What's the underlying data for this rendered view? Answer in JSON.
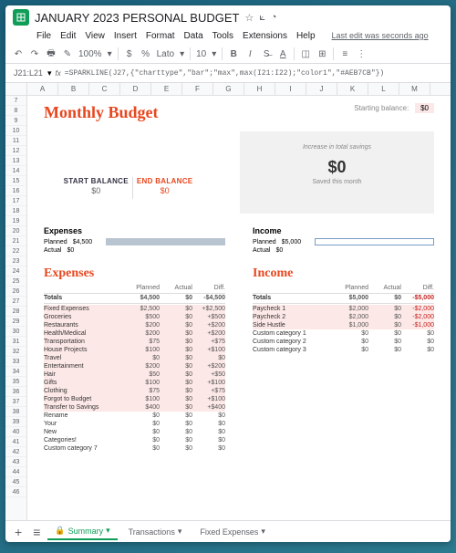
{
  "doc": {
    "name": "JANUARY 2023 PERSONAL BUDGET",
    "lastedit": "Last edit was seconds ago"
  },
  "menus": [
    "File",
    "Edit",
    "View",
    "Insert",
    "Format",
    "Data",
    "Tools",
    "Extensions",
    "Help"
  ],
  "toolbar": {
    "zoom": "100%",
    "font": "Lato",
    "fontsize": "10"
  },
  "formula": {
    "cell": "J21:L21",
    "fx": "fx",
    "value": "=SPARKLINE(J27,{\"charttype\",\"bar\";\"max\",max(I21:I22);\"color1\",\"#AEB7CB\"})"
  },
  "cols": [
    "A",
    "B",
    "C",
    "D",
    "E",
    "F",
    "G",
    "H",
    "I",
    "J",
    "K",
    "L",
    "M"
  ],
  "rows": [
    "7",
    "8",
    "9",
    "10",
    "11",
    "12",
    "13",
    "14",
    "15",
    "16",
    "17",
    "18",
    "19",
    "20",
    "21",
    "22",
    "23",
    "24",
    "25",
    "26",
    "27",
    "28",
    "29",
    "30",
    "31",
    "32",
    "33",
    "34",
    "35",
    "36",
    "37",
    "38",
    "39",
    "40",
    "41",
    "42",
    "43",
    "44",
    "45",
    "46"
  ],
  "title": "Monthly Budget",
  "startbal": {
    "label": "Starting balance:",
    "value": "$0"
  },
  "bal": {
    "startlab": "START BALANCE",
    "startval": "$0",
    "endlab": "END BALANCE",
    "endval": "$0"
  },
  "savings": {
    "lab1": "Increase in total savings",
    "value": "$0",
    "lab2": "Saved this month"
  },
  "exp": {
    "label": "Expenses",
    "planned_lab": "Planned",
    "planned_val": "$4,500",
    "actual_lab": "Actual",
    "actual_val": "$0"
  },
  "inc": {
    "label": "Income",
    "planned_lab": "Planned",
    "planned_val": "$5,000",
    "actual_lab": "Actual",
    "actual_val": "$0"
  },
  "expdet": {
    "title": "Expenses",
    "cols": [
      "",
      "Planned",
      "Actual",
      "Diff."
    ],
    "total": [
      "Totals",
      "$4,500",
      "$0",
      "-$4,500"
    ],
    "rows": [
      [
        "Fixed Expenses",
        "$2,500",
        "$0",
        "+$2,500"
      ],
      [
        "Groceries",
        "$500",
        "$0",
        "+$500"
      ],
      [
        "Restaurants",
        "$200",
        "$0",
        "+$200"
      ],
      [
        "Health/Medical",
        "$200",
        "$0",
        "+$200"
      ],
      [
        "Transportation",
        "$75",
        "$0",
        "+$75"
      ],
      [
        "House Projects",
        "$100",
        "$0",
        "+$100"
      ],
      [
        "Travel",
        "$0",
        "$0",
        "$0"
      ],
      [
        "Entertainment",
        "$200",
        "$0",
        "+$200"
      ],
      [
        "Hair",
        "$50",
        "$0",
        "+$50"
      ],
      [
        "Gifts",
        "$100",
        "$0",
        "+$100"
      ],
      [
        "Clothing",
        "$75",
        "$0",
        "+$75"
      ],
      [
        "Forgot to Budget",
        "$100",
        "$0",
        "+$100"
      ],
      [
        "Transfer to Savings",
        "$400",
        "$0",
        "+$400"
      ],
      [
        "Rename",
        "$0",
        "$0",
        "$0"
      ],
      [
        "Your",
        "$0",
        "$0",
        "$0"
      ],
      [
        "New",
        "$0",
        "$0",
        "$0"
      ],
      [
        "Categories!",
        "$0",
        "$0",
        "$0"
      ],
      [
        "Custom category 7",
        "$0",
        "$0",
        "$0"
      ]
    ]
  },
  "incdet": {
    "title": "Income",
    "cols": [
      "",
      "Planned",
      "Actual",
      "Diff."
    ],
    "total": [
      "Totals",
      "$5,000",
      "$0",
      "-$5,000"
    ],
    "rows": [
      [
        "Paycheck 1",
        "$2,000",
        "$0",
        "-$2,000"
      ],
      [
        "Paycheck 2",
        "$2,000",
        "$0",
        "-$2,000"
      ],
      [
        "Side Hustle",
        "$1,000",
        "$0",
        "-$1,000"
      ],
      [
        "Custom category 1",
        "$0",
        "$0",
        "$0"
      ],
      [
        "Custom category 2",
        "$0",
        "$0",
        "$0"
      ],
      [
        "Custom category 3",
        "$0",
        "$0",
        "$0"
      ]
    ]
  },
  "tabs": {
    "summary": "Summary",
    "transactions": "Transactions",
    "fixed": "Fixed Expenses"
  }
}
